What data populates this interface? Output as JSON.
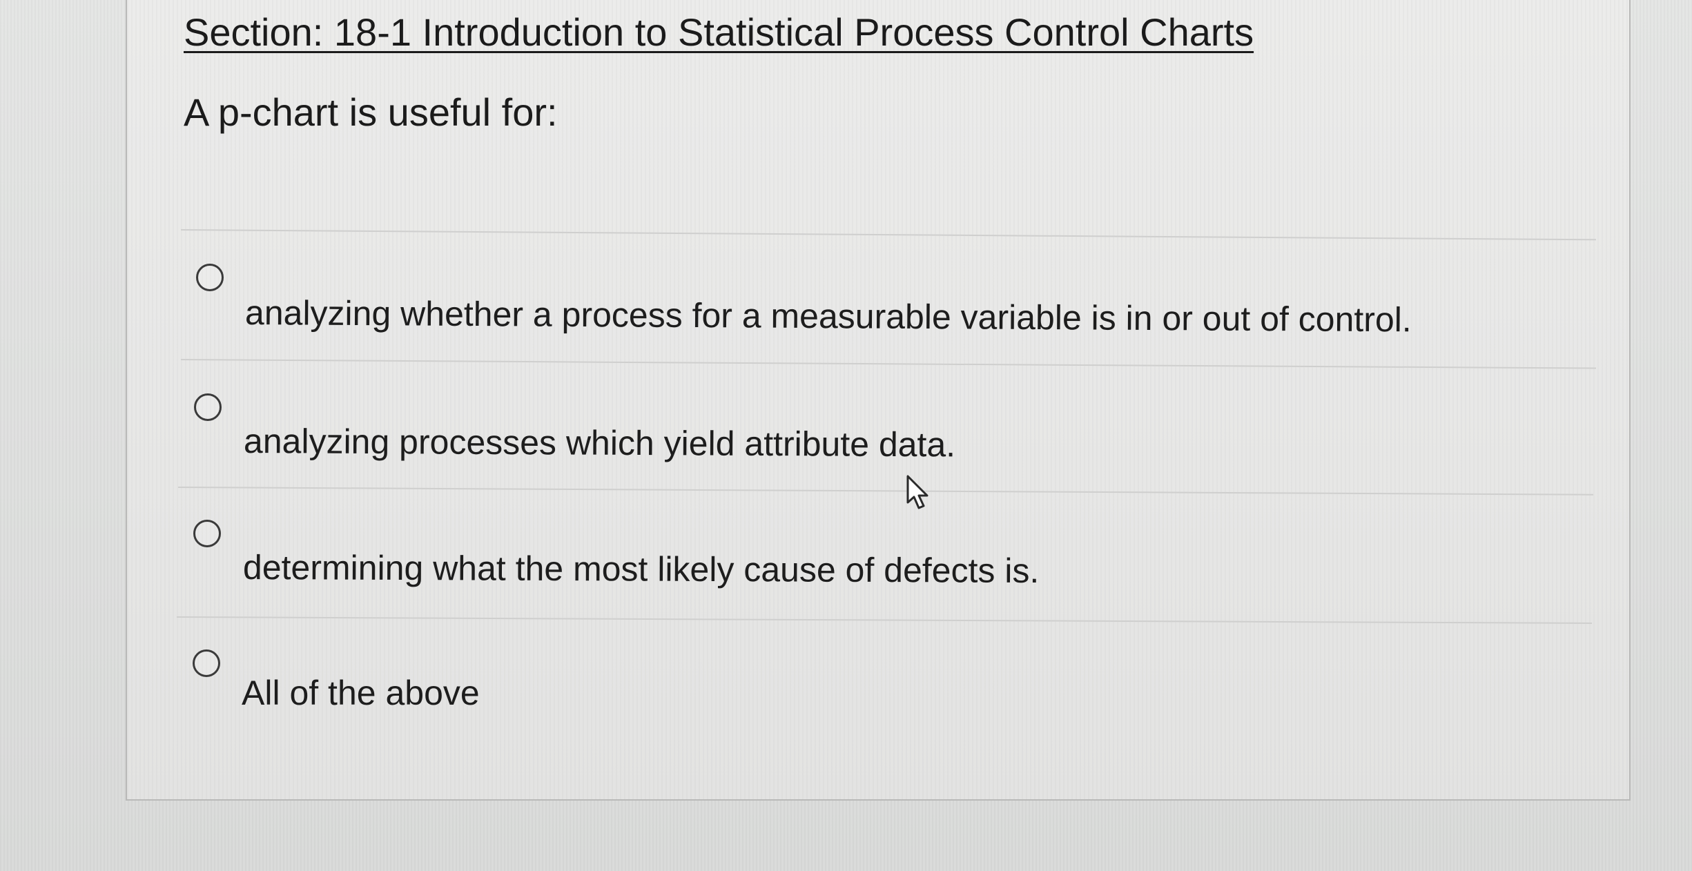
{
  "section": {
    "title": "Section:  18-1 Introduction to Statistical Process Control Charts"
  },
  "question": {
    "text": "A p-chart is useful for:"
  },
  "options": [
    {
      "label": "analyzing whether a process for a measurable variable is in or out of control."
    },
    {
      "label": "analyzing processes which yield attribute data."
    },
    {
      "label": "determining what the most likely cause of defects is."
    },
    {
      "label": "All of the above"
    }
  ],
  "icons": {
    "radio": "radio-button-icon",
    "cursor": "mouse-pointer-icon"
  }
}
